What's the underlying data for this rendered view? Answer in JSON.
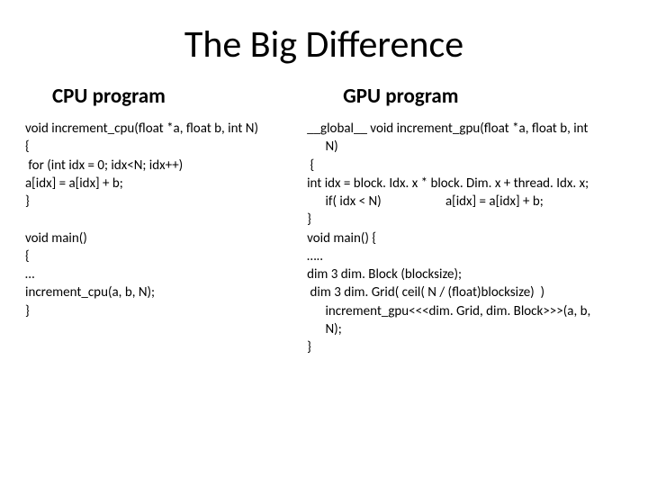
{
  "title": "The Big Difference",
  "left": {
    "heading": "CPU program",
    "code": "void increment_cpu(float *a, float b, int N)\n{\n for (int idx = 0; idx<N; idx++)\na[idx] = a[idx] + b;\n}\n\nvoid main()\n{\n…\nincrement_cpu(a, b, N);\n}"
  },
  "right": {
    "heading": "GPU program",
    "code": "__global__ void increment_gpu(float *a, float b, int\n      N)\n {\nint idx = block. Idx. x * block. Dim. x + thread. Idx. x;\n      if( idx < N)                     a[idx] = a[idx] + b;\n}\nvoid main() {\n…..\ndim 3 dim. Block (blocksize);\n dim 3 dim. Grid( ceil( N / (float)blocksize)  )\n      increment_gpu<<<dim. Grid, dim. Block>>>(a, b,\n      N);\n}"
  }
}
